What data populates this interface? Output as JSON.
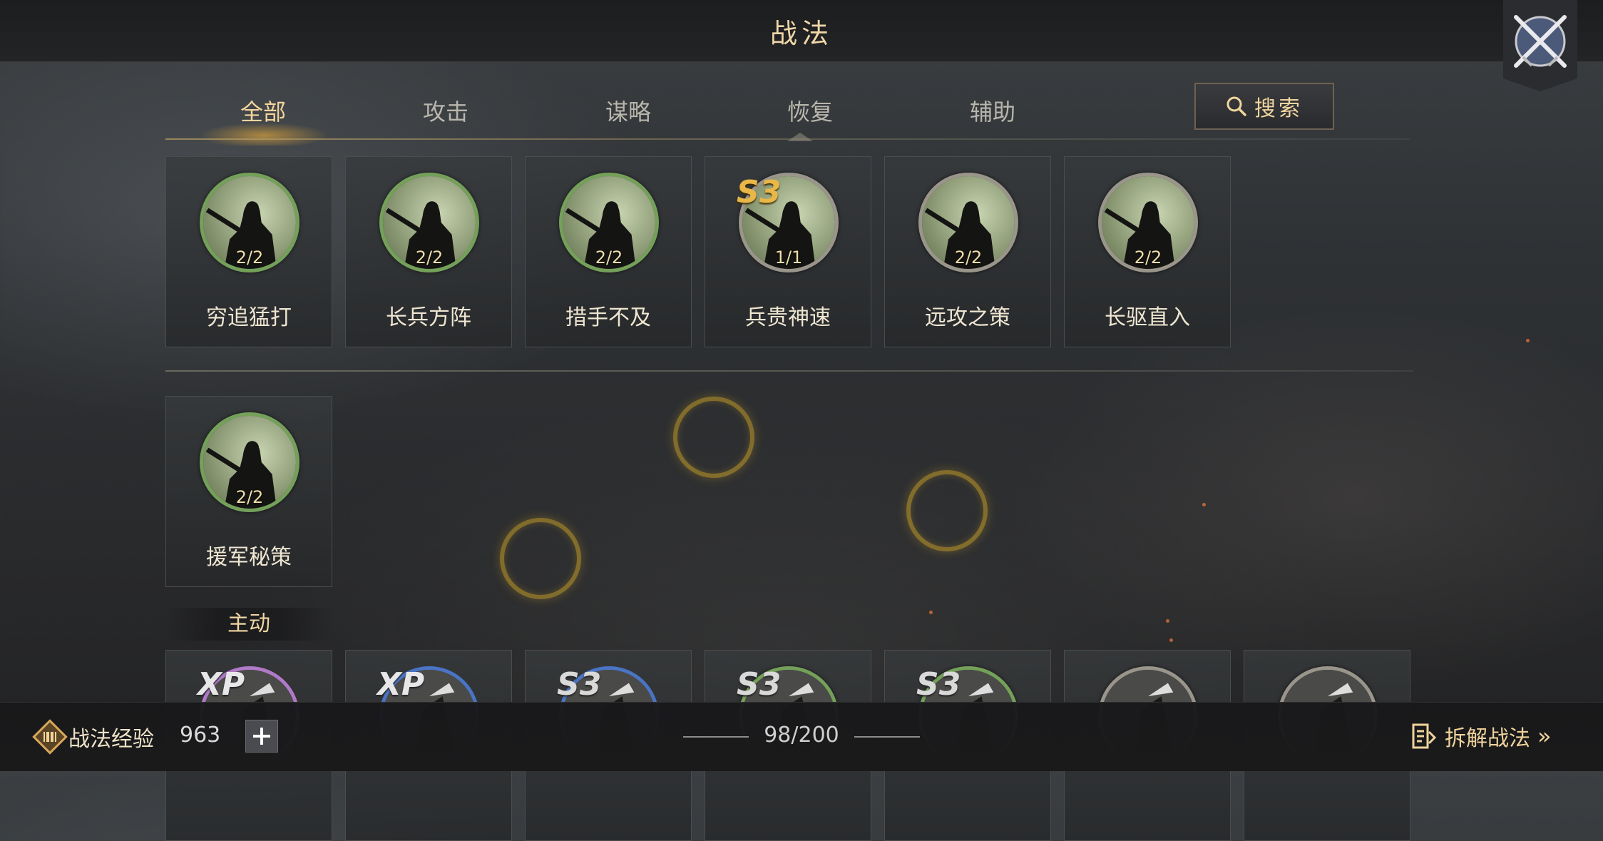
{
  "header": {
    "title": "战法"
  },
  "tabs": [
    {
      "label": "全部",
      "active": true
    },
    {
      "label": "攻击",
      "active": false
    },
    {
      "label": "谋略",
      "active": false
    },
    {
      "label": "恢复",
      "active": false
    },
    {
      "label": "辅助",
      "active": false
    }
  ],
  "search": {
    "label": "搜索"
  },
  "row1": [
    {
      "name": "穷追猛打",
      "count": "2/2",
      "frame": "green"
    },
    {
      "name": "长兵方阵",
      "count": "2/2",
      "frame": "green"
    },
    {
      "name": "措手不及",
      "count": "2/2",
      "frame": "green"
    },
    {
      "name": "兵贵神速",
      "count": "1/1",
      "frame": "gray",
      "badge": "S3"
    },
    {
      "name": "远攻之策",
      "count": "2/2",
      "frame": "gray"
    },
    {
      "name": "长驱直入",
      "count": "2/2",
      "frame": "gray"
    }
  ],
  "row2": [
    {
      "name": "援军秘策",
      "count": "2/2",
      "frame": "green"
    }
  ],
  "section": {
    "label": "主动"
  },
  "row3_badges": [
    "XP",
    "XP",
    "S3",
    "S3",
    "S3"
  ],
  "bottom": {
    "exp_label": "战法经验",
    "exp_value": "963",
    "capacity": "98/200",
    "disassemble_label": "拆解战法"
  }
}
